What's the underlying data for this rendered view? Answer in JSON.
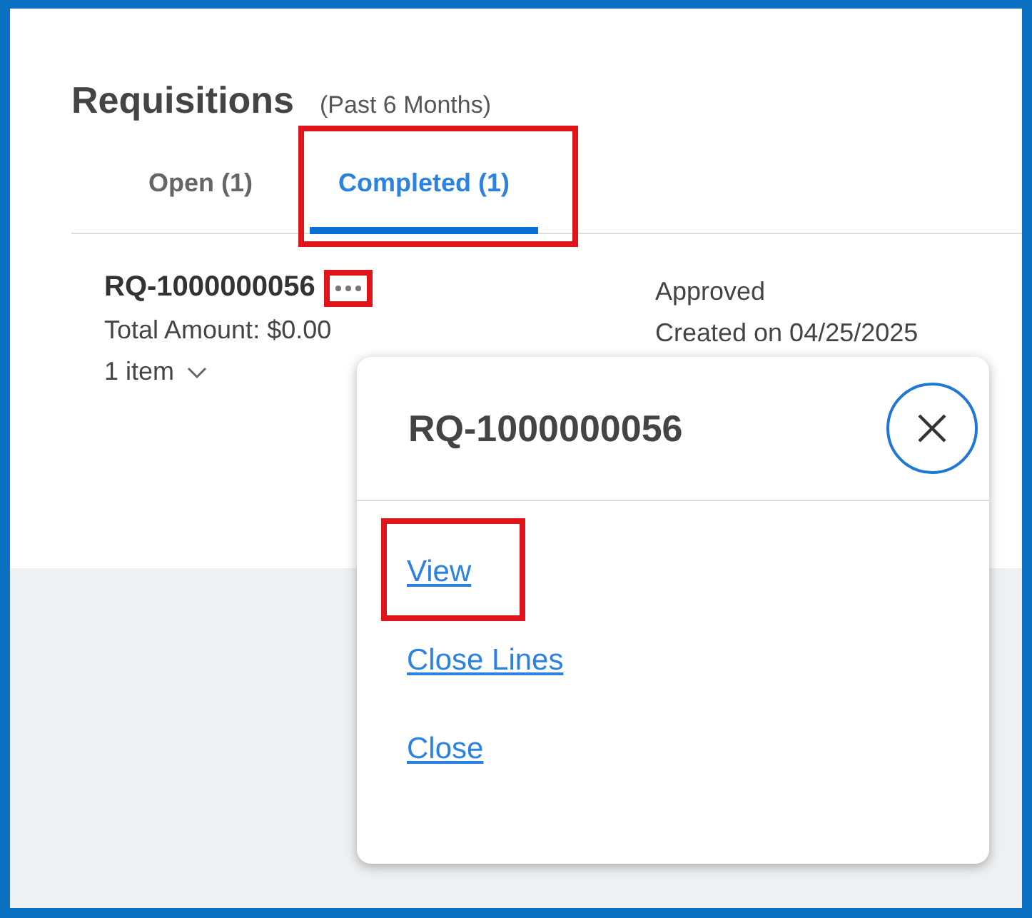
{
  "header": {
    "title": "Requisitions",
    "subtitle": "(Past 6 Months)"
  },
  "tabs": [
    {
      "label": "Open (1)",
      "selected": false,
      "highlighted": false
    },
    {
      "label": "Completed (1)",
      "selected": true,
      "highlighted": true
    }
  ],
  "requisition": {
    "id": "RQ-1000000056",
    "actions_highlighted": true,
    "total": "Total Amount: $0.00",
    "items": "1 item",
    "status": "Approved",
    "created": "Created on 04/25/2025"
  },
  "popup": {
    "title": "RQ-1000000056",
    "actions": [
      {
        "label": "View",
        "highlighted": true
      },
      {
        "label": "Close Lines",
        "highlighted": false
      },
      {
        "label": "Close",
        "highlighted": false
      }
    ]
  }
}
